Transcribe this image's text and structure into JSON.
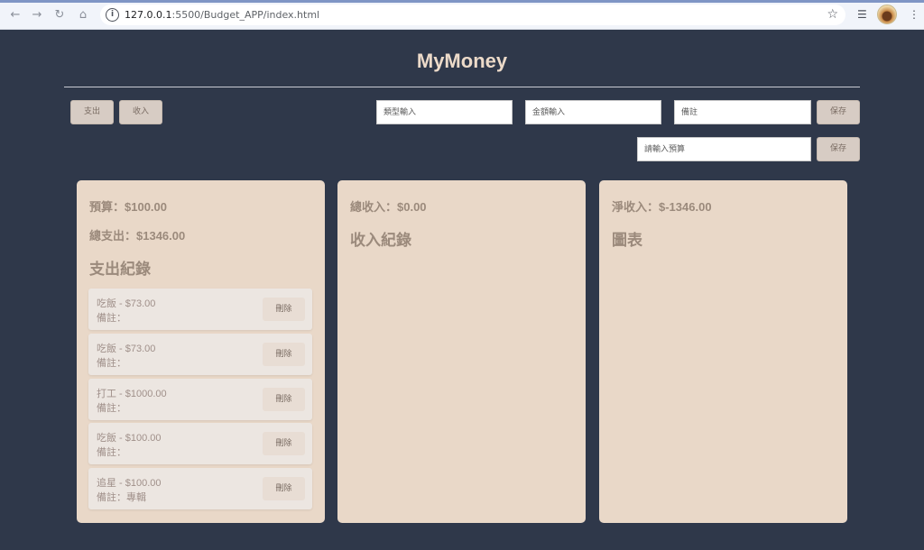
{
  "browser": {
    "url_host": "127.0.0.1",
    "url_path": ":5500/Budget_APP/index.html"
  },
  "app": {
    "title": "MyMoney"
  },
  "toolbar": {
    "expense_label": "支出",
    "income_label": "收入",
    "type_placeholder": "類型輸入",
    "amount_placeholder": "金額輸入",
    "note_placeholder": "備註",
    "save_label": "保存",
    "budget_placeholder": "請輸入預算",
    "budget_save_label": "保存"
  },
  "expense_panel": {
    "budget": "預算：$100.00",
    "total_expense": "總支出：$1346.00",
    "heading": "支出紀錄",
    "records": [
      {
        "title": "吃飯 - $73.00",
        "note": "備註：",
        "delete_label": "刪除"
      },
      {
        "title": "吃飯 - $73.00",
        "note": "備註：",
        "delete_label": "刪除"
      },
      {
        "title": "打工 - $1000.00",
        "note": "備註：",
        "delete_label": "刪除"
      },
      {
        "title": "吃飯 - $100.00",
        "note": "備註：",
        "delete_label": "刪除"
      },
      {
        "title": "追星 - $100.00",
        "note": "備註：專輯",
        "delete_label": "刪除"
      }
    ]
  },
  "income_panel": {
    "total_income": "總收入：$0.00",
    "heading": "收入紀錄"
  },
  "summary_panel": {
    "net_income": "淨收入：$-1346.00",
    "heading": "圖表"
  },
  "colors": {
    "page_bg": "#2f384a",
    "panel_bg": "#e9d8c8",
    "title": "#ecdac9",
    "button_bg": "#d7ccc4"
  }
}
